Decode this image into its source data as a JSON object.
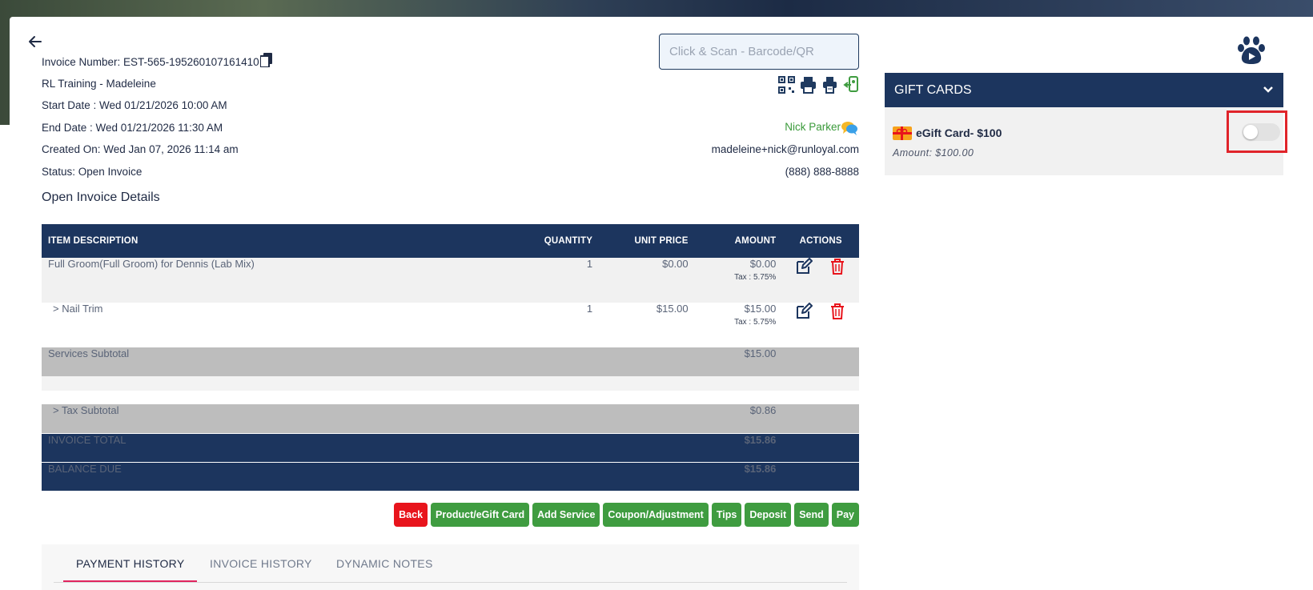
{
  "invoice": {
    "number_label": "Invoice Number: EST-565-195260107161410",
    "location": "RL Training - Madeleine",
    "start_date": "Start Date : Wed 01/21/2026 10:00 AM",
    "end_date": "End Date : Wed 01/21/2026 11:30 AM",
    "created_on": "Created On: Wed Jan 07, 2026 11:14 am",
    "status": "Status: Open Invoice",
    "section_title": "Open Invoice Details"
  },
  "scan": {
    "placeholder": "Click & Scan - Barcode/QR"
  },
  "toolbar_icons": [
    "qr-code-icon",
    "print-icon",
    "receipt-print-icon",
    "mobile-payment-icon"
  ],
  "customer": {
    "name": "Nick Parker",
    "email": "madeleine+nick@runloyal.com",
    "phone": "(888) 888-8888"
  },
  "table": {
    "headers": {
      "description": "ITEM DESCRIPTION",
      "quantity": "QUANTITY",
      "unit_price": "UNIT PRICE",
      "amount": "AMOUNT",
      "actions": "ACTIONS"
    },
    "rows": [
      {
        "description": "Full Groom(Full Groom) for Dennis (Lab Mix)",
        "quantity": "1",
        "unit_price": "$0.00",
        "amount": "$0.00",
        "tax": "Tax : 5.75%"
      },
      {
        "description": ">   Nail Trim",
        "quantity": "1",
        "unit_price": "$15.00",
        "amount": "$15.00",
        "tax": "Tax : 5.75%"
      }
    ],
    "services_subtotal_label": "Services Subtotal",
    "services_subtotal": "$15.00",
    "tax_subtotal_label": ">   Tax Subtotal",
    "tax_subtotal": "$0.86",
    "invoice_total_label": "INVOICE TOTAL",
    "invoice_total": "$15.86",
    "balance_due_label": "BALANCE DUE",
    "balance_due": "$15.86"
  },
  "buttons": {
    "back": "Back",
    "product_gift": "Product/eGift Card",
    "add_service": "Add Service",
    "coupon": "Coupon/Adjustment",
    "tips": "Tips",
    "deposit": "Deposit",
    "send": "Send",
    "pay": "Pay"
  },
  "tabs": [
    "PAYMENT HISTORY",
    "INVOICE HISTORY",
    "DYNAMIC NOTES"
  ],
  "gift_cards": {
    "header": "GIFT CARDS",
    "card_title": "eGift Card- $100",
    "card_amount": "Amount: $100.00",
    "toggle_on": false
  },
  "colors": {
    "navy": "#1c355e",
    "green": "#3f9c40",
    "red": "#e8141c",
    "highlight": "#e0242a"
  }
}
